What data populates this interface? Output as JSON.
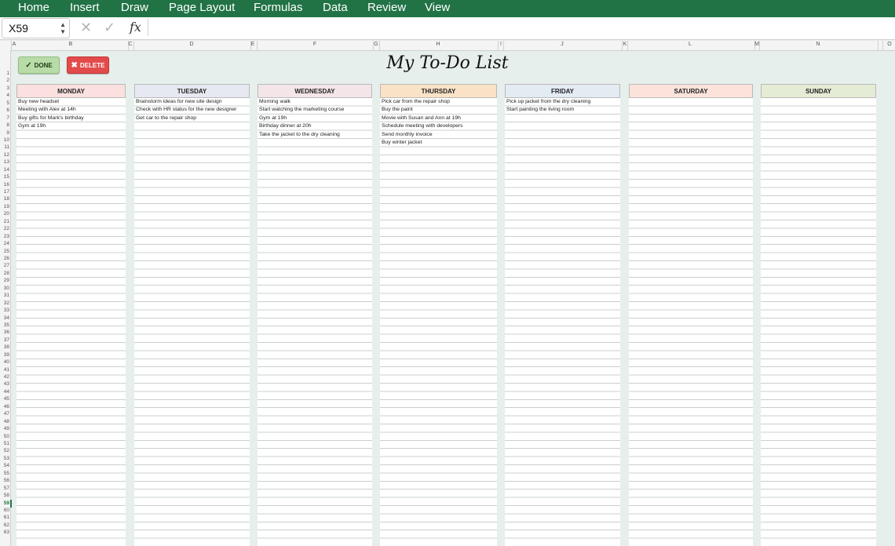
{
  "ribbon": {
    "tabs": [
      "Home",
      "Insert",
      "Draw",
      "Page Layout",
      "Formulas",
      "Data",
      "Review",
      "View"
    ]
  },
  "formula_bar": {
    "name_box": "X59",
    "fx_label": "fx",
    "cancel_glyph": "✕",
    "confirm_glyph": "✓"
  },
  "columns": [
    "A",
    "B",
    "C",
    "D",
    "E",
    "F",
    "G",
    "H",
    "I",
    "J",
    "K",
    "L",
    "M",
    "N",
    "O"
  ],
  "active_row": 59,
  "buttons": {
    "done": "DONE",
    "delete": "DELETE",
    "done_glyph": "✓",
    "delete_glyph": "✖"
  },
  "title": "My To-Do List",
  "days": [
    {
      "name": "MONDAY",
      "color": "#fbe0e0",
      "items": [
        "Buy new headset",
        "Meeting with Alex at 14h",
        "Buy gifts for Mark's birthday",
        "Gym at 19h"
      ]
    },
    {
      "name": "TUESDAY",
      "color": "#e6e9f2",
      "items": [
        "Brainstorm ideas for new site design",
        "Check with HR status for the new designer",
        "Get car to the repair shop"
      ]
    },
    {
      "name": "WEDNESDAY",
      "color": "#f4e5e8",
      "items": [
        "Morning walk",
        "Start watching the marketing course",
        "Gym at 19h",
        "Birthday dinner at 20h",
        "Take the jacket to the dry cleaning"
      ]
    },
    {
      "name": "THURSDAY",
      "color": "#fae2c6",
      "items": [
        "Pick car from the repair shop",
        "Buy the paint",
        "Movie with Susan and Ann at 19h",
        "Schedule meeting with developers",
        "Send monthly invoice",
        "Buy winter jacket"
      ]
    },
    {
      "name": "FRIDAY",
      "color": "#e3ebf3",
      "items": [
        "Pick up jacket from the dry cleaning",
        "Start painting the living room"
      ]
    },
    {
      "name": "SATURDAY",
      "color": "#fbe3dc",
      "items": []
    },
    {
      "name": "SUNDAY",
      "color": "#e5ecd5",
      "items": []
    }
  ]
}
